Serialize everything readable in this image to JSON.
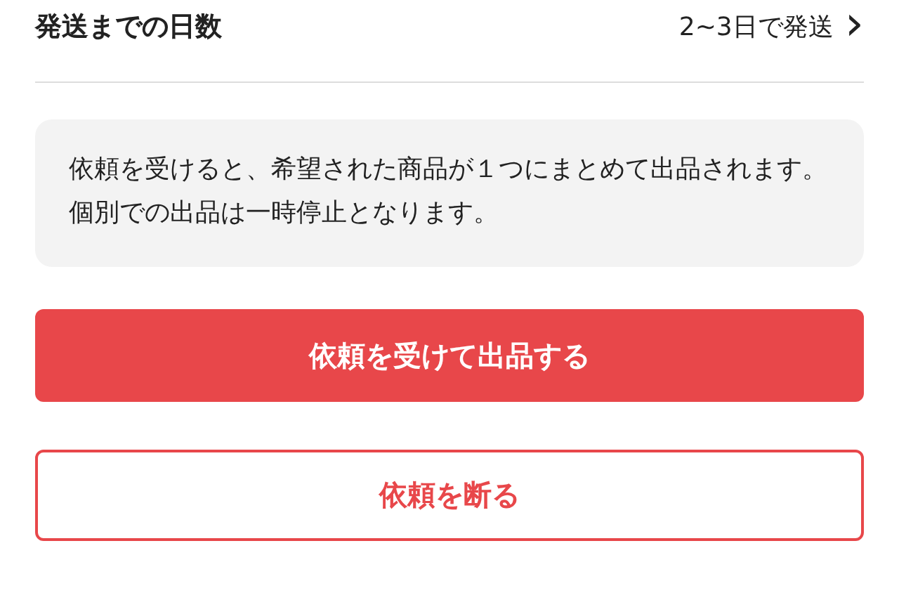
{
  "shipping_row": {
    "label": "発送までの日数",
    "value": "2~3日で発送",
    "chevron": "›"
  },
  "notice": "依頼を受けると、希望された商品が１つにまとめて出品されます。個別での出品は一時停止となります。",
  "buttons": [
    {
      "kind": "primary",
      "label": "依頼を受けて出品する"
    },
    {
      "kind": "outline",
      "label": "依頼を断る"
    }
  ]
}
